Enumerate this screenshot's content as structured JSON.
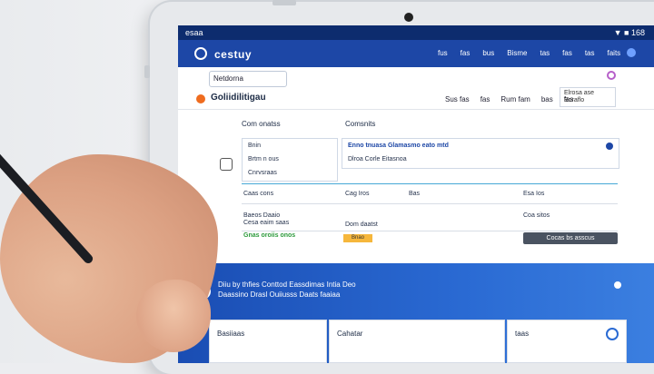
{
  "status_bar": {
    "left": "esaa",
    "right": "▼ ■ 168"
  },
  "app_bar": {
    "brand": "cestuy",
    "links": [
      "fus",
      "fas",
      "bus",
      "Bisme",
      "tas",
      "fas",
      "tas",
      "faits"
    ]
  },
  "sub_bar": {
    "search_value": "Netdorna",
    "title": "Goliidilitigau",
    "nav": [
      "Sus fas",
      "fas",
      "Rum fam",
      "bas",
      "fas"
    ],
    "side_select": [
      "Elrosa ase",
      "Boraflo"
    ]
  },
  "content": {
    "label_left": "Com onatss",
    "label_right": "Comsnits",
    "panel_main": [
      "Enno tnuasa Glamasmo eato mtd",
      "Dlroa Corle Eitasnoa"
    ],
    "left_col": [
      "Bnin",
      "Brtm n ous",
      "Cnrvsraas"
    ],
    "rows": [
      {
        "a": "Caas cons",
        "b": "Cag Iros",
        "c": "Bas",
        "d": "Esa Ios"
      },
      {
        "a": "Cesa eaim saas",
        "b": "",
        "c": "",
        "d": ""
      },
      {
        "a": "Baeos Daaio",
        "b": "Dom daatst",
        "c": "",
        "d": "Coa sitos"
      }
    ],
    "green_text": "Gnas oroiis onos",
    "chip": "Bnao",
    "dark_button": "Cocas bs asscus"
  },
  "banner": {
    "text": "Diiu by thfies Conttod Eassdimas Intia Deo Daassino Drasl Ouiiusss Daats faaiaa"
  },
  "cards": [
    {
      "label": "Basiiaas"
    },
    {
      "label": "Cahatar"
    },
    {
      "label": "taas"
    }
  ],
  "colors": {
    "status": "#0d2c6e",
    "appbar": "#1d47a6",
    "banner": "#2a6ad3",
    "accent": "#ef6c1f"
  }
}
